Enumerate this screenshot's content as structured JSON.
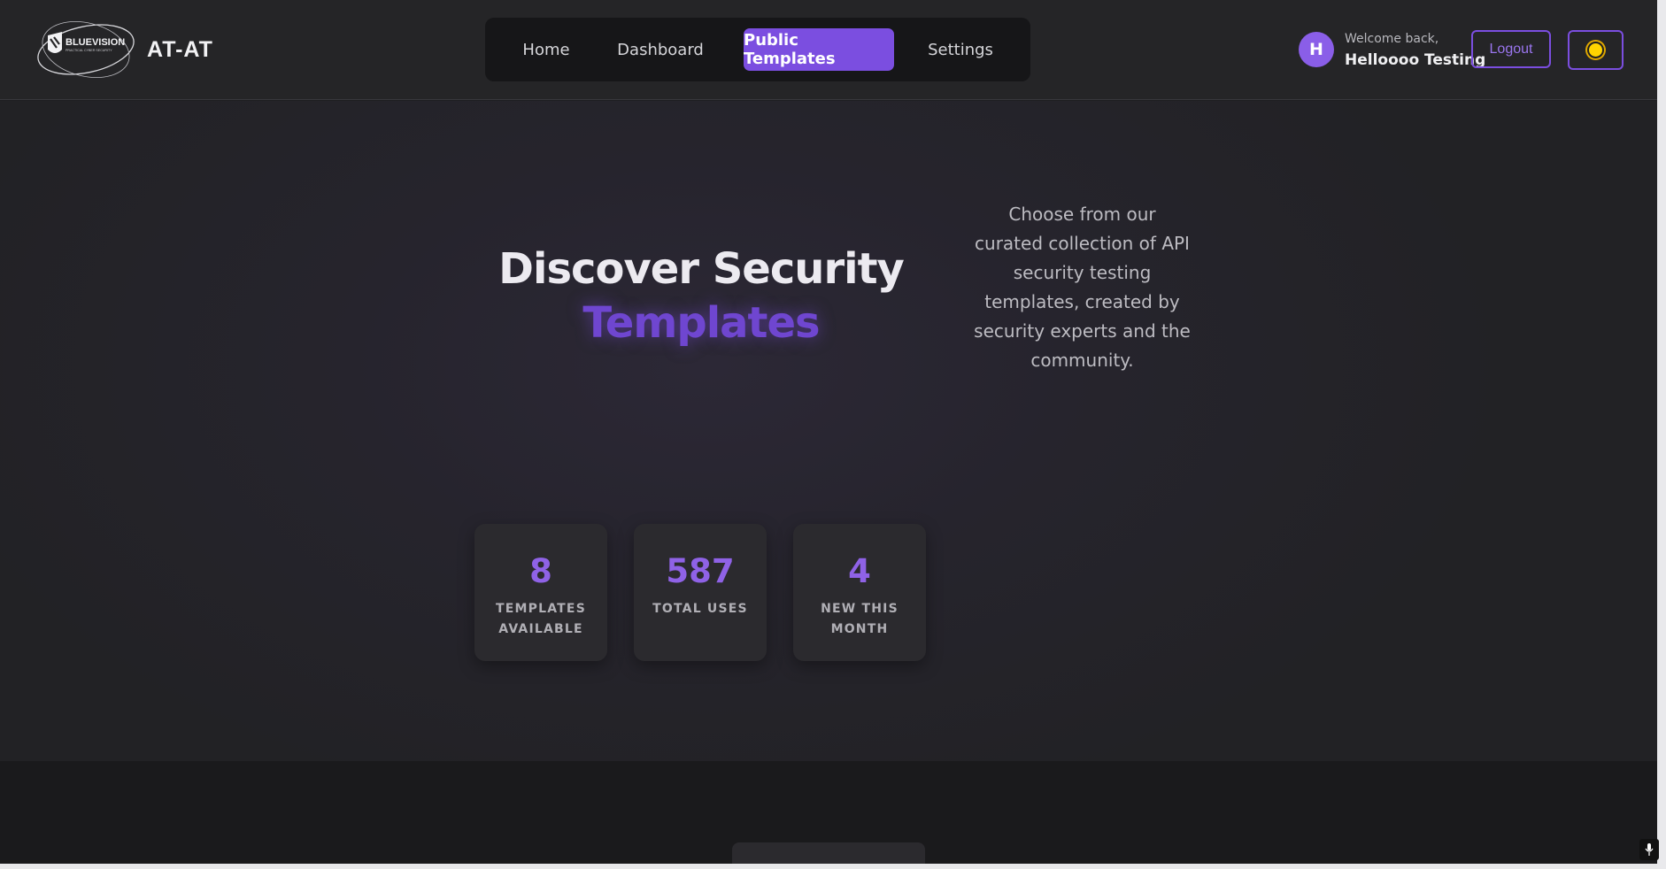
{
  "header": {
    "logo_text": "BLUEVISION",
    "logo_tagline": "PRACTICAL CYBER SECURITY",
    "app_title": "AT-AT",
    "nav": {
      "items": [
        {
          "label": "Home"
        },
        {
          "label": "Dashboard"
        },
        {
          "label": "Public Templates",
          "active": true
        },
        {
          "label": "Settings"
        }
      ]
    },
    "user": {
      "avatar_initial": "H",
      "welcome": "Welcome back,",
      "name": "Helloooo Testing"
    },
    "logout_label": "Logout",
    "theme_toggle_icon": "sun-icon"
  },
  "hero": {
    "title_line1": "Discover Security",
    "title_line2": "Templates",
    "description": "Choose from our curated collection of API security testing templates, created by security experts and the community."
  },
  "stats": [
    {
      "value": "8",
      "label": "TEMPLATES AVAILABLE"
    },
    {
      "value": "587",
      "label": "TOTAL USES"
    },
    {
      "value": "4",
      "label": "NEW THIS MONTH"
    }
  ],
  "colors": {
    "accent": "#7b4ee0",
    "accent_text": "#8f62e6",
    "background": "#1e1e21",
    "header_bg": "#252527"
  }
}
